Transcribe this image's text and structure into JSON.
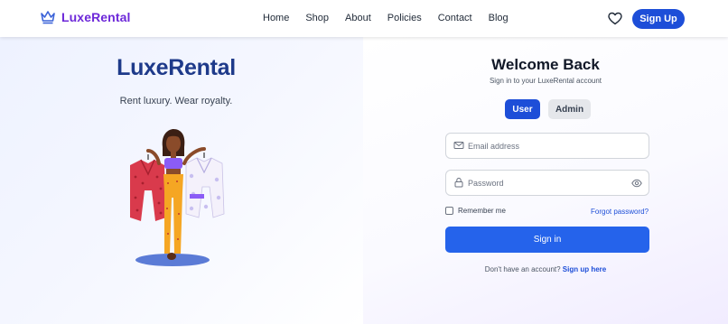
{
  "nav": {
    "brand": "LuxeRental",
    "links": [
      "Home",
      "Shop",
      "About",
      "Policies",
      "Contact",
      "Blog"
    ],
    "signup_label": "Sign Up"
  },
  "left": {
    "title": "LuxeRental",
    "tagline": "Rent luxury. Wear royalty."
  },
  "login": {
    "title": "Welcome Back",
    "subtitle": "Sign in to your LuxeRental account",
    "roles": [
      "User",
      "Admin"
    ],
    "active_role": "User",
    "email_placeholder": "Email address",
    "password_placeholder": "Password",
    "remember_label": "Remember me",
    "forgot_label": "Forgot password?",
    "signin_label": "Sign in",
    "no_account_text": "Don't have an account?",
    "signup_link": "Sign up here"
  },
  "colors": {
    "brand": "#6d28d9",
    "primary": "#1d4ed8",
    "title": "#1e3a8a"
  }
}
